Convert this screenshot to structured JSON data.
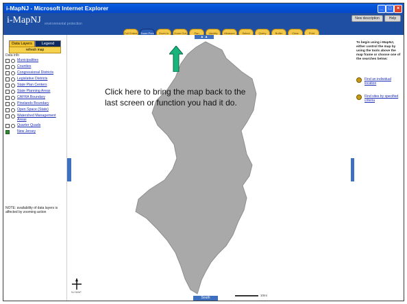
{
  "window": {
    "title": "i-MapNJ - Microsoft Internet Explorer",
    "controls": [
      "_",
      "□",
      "×"
    ]
  },
  "header": {
    "logo": "i-MapNJ",
    "tagline": "environmental protection",
    "buttons": [
      "New description",
      "Help"
    ]
  },
  "toolbar": {
    "tools": [
      "Full Extent",
      "Zoom Prev",
      "Zoom In",
      "Zoom Out",
      "Pan",
      "Identify",
      "Measure",
      "Select",
      "Query",
      "Buffer",
      "Clear",
      "Print"
    ],
    "active_index": 1
  },
  "left_panel": {
    "tabs": [
      "Data Layers",
      "Legend"
    ],
    "active_tab": 0,
    "refresh_label": "refresh map",
    "section_header": "Data info",
    "layers": [
      {
        "label": "Municipalities",
        "checked": false
      },
      {
        "label": "Counties",
        "checked": false
      },
      {
        "label": "Congressional Districts",
        "checked": false
      },
      {
        "label": "Legislative Districts",
        "checked": false
      },
      {
        "label": "State Plan Centers",
        "checked": false
      },
      {
        "label": "State Planning Areas",
        "checked": false
      },
      {
        "label": "CAFRA Boundary",
        "checked": false
      },
      {
        "label": "Pinelands Boundary",
        "checked": false
      },
      {
        "label": "Open Space (State)",
        "checked": false
      },
      {
        "label": "Watershed Management Areas",
        "checked": false
      },
      {
        "label": "Quarter Quads",
        "checked": false
      },
      {
        "label": "New Jersey",
        "checked": true
      }
    ],
    "note": "NOTE: availability of data layers is affected by zooming action"
  },
  "map": {
    "callout_text": "Click here to bring the map back to the last screen or function you had it do.",
    "pan_bottom_label": "South",
    "compass_label": "NJ MAP",
    "scale_label": "10mi"
  },
  "right_panel": {
    "intro": "To begin using i-MapNJ, either control the map by using the tools above the map frame or choose one of the searches below:",
    "links": [
      "Find an individual location",
      "Find sites by specified criteria"
    ]
  },
  "colors": {
    "header_blue": "#1f4fa3",
    "tool_yellow": "#f2c84b",
    "map_gray": "#a9a9a9",
    "arrow_green": "#19b37c"
  }
}
